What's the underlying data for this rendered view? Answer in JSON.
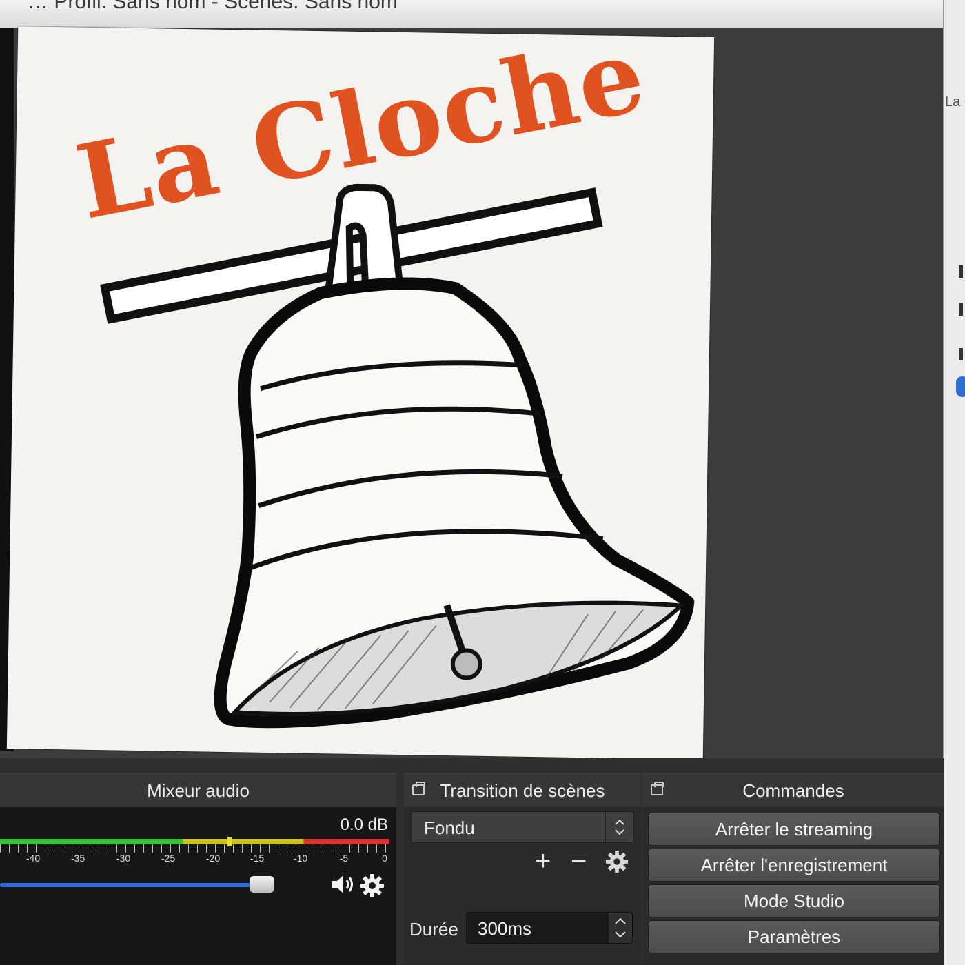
{
  "window": {
    "title": "… Profil: Sans nom - Scènes: Sans nom"
  },
  "background_window": {
    "fragment": "La C"
  },
  "preview": {
    "logo_text": "La Cloche",
    "colors": {
      "logo": "#e0521f",
      "canvas": "#f4f3f0"
    }
  },
  "mixer": {
    "header": "Mixeur audio",
    "db": "0.0 dB",
    "ticks": [
      "-40",
      "-35",
      "-30",
      "-25",
      "-20",
      "-15",
      "-10",
      "-5",
      "0"
    ],
    "volume": 0.78,
    "icons": [
      "speaker-icon",
      "gear-icon"
    ]
  },
  "transition": {
    "header": "Transition de scènes",
    "selected": "Fondu",
    "add_symbol": "+",
    "remove_symbol": "−",
    "duration_label": "Durée",
    "duration_value": "300ms"
  },
  "commands": {
    "header": "Commandes",
    "buttons": [
      "Arrêter le streaming",
      "Arrêter l'enregistrement",
      "Mode Studio",
      "Paramètres"
    ]
  }
}
